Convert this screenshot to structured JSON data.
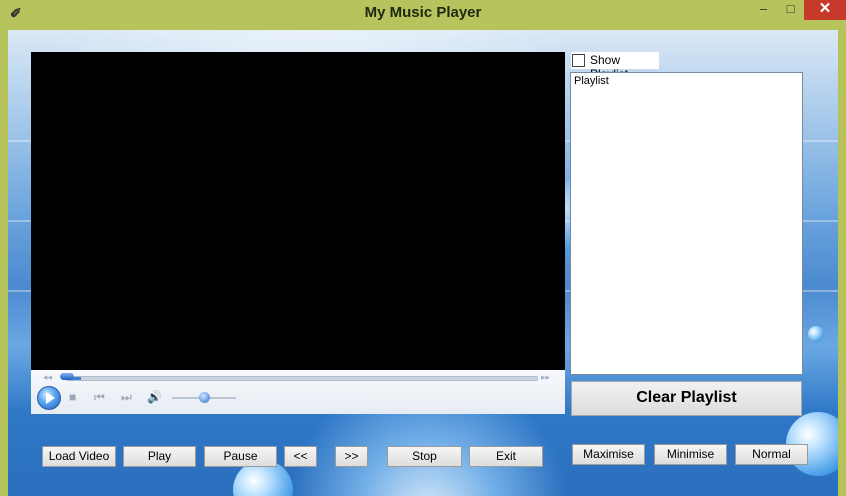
{
  "window": {
    "title": "My Music Player",
    "controls": {
      "minimize": "–",
      "maximize": "□",
      "close": "✕"
    }
  },
  "player": {
    "seek_progress_percent": 3,
    "volume_percent": 50
  },
  "playlist": {
    "show_label": "Show Playlist",
    "show_checked": false,
    "items": [
      "Playlist"
    ],
    "clear_label": "Clear Playlist"
  },
  "buttons": {
    "load_video": "Load Video",
    "play": "Play",
    "pause": "Pause",
    "rewind": "<<",
    "forward": ">>",
    "stop": "Stop",
    "exit": "Exit",
    "maximise": "Maximise",
    "minimise": "Minimise",
    "normal": "Normal"
  },
  "colors": {
    "titlebar": "#b7c45d",
    "close": "#c7392b",
    "accent": "#3b7fd9"
  }
}
